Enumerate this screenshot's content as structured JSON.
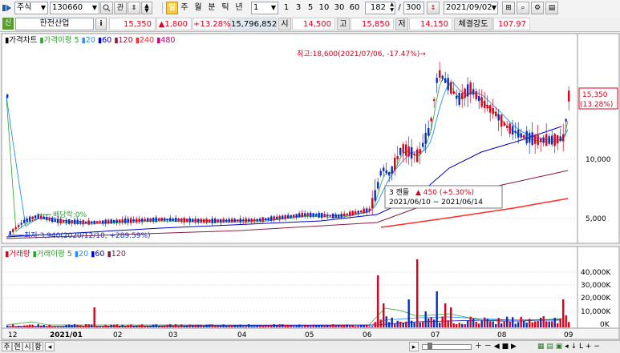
{
  "toolbar": {
    "market_select": "주식",
    "code": "130660",
    "chip_gwan": "관",
    "period_active": "일",
    "periods": [
      "주",
      "월",
      "분",
      "틱",
      "년"
    ],
    "interval_select": "1",
    "quick_intervals": [
      "1",
      "3",
      "5",
      "10",
      "30",
      "60"
    ],
    "count_value": "182",
    "total_value": "300",
    "date_value": "2021/09/02"
  },
  "quote": {
    "badge": "신",
    "name": "한전산업",
    "info": "i",
    "price": "15,350",
    "change": "▲1,800",
    "change_pct": "+13.28%",
    "volume": "15,796,852",
    "open_label": "시",
    "open": "14,500",
    "high_label": "고",
    "high": "15,850",
    "low_label": "저",
    "low": "14,150",
    "strength_label": "체결강도",
    "strength": "107.97"
  },
  "price_panel": {
    "legend": [
      "가격차트",
      "가격이평 5",
      "20",
      "60",
      "120",
      "240",
      "480"
    ],
    "high_note": "최고:18,600(2021/07/06, -17.47%)→",
    "low_note": "최저:3,940(2020/12/10, +289.59%)",
    "dividend_note": "배당락:0%",
    "tooltip_line1_a": "3 캔들",
    "tooltip_line1_b": "▲ 450 (+5.30%)",
    "tooltip_line2": "2021/06/10 ~ 2021/06/14",
    "yticks": [
      "10,000",
      "5,000"
    ],
    "last_price": "15,350",
    "last_pct": "(13.28%)"
  },
  "volume_panel": {
    "legend": [
      "거래량",
      "거래이평 5",
      "20",
      "60",
      "120"
    ],
    "yticks": [
      "40,000K",
      "30,000K",
      "20,000K",
      "10,000K",
      "0K"
    ]
  },
  "xaxis": [
    "12",
    "2021/01",
    "02",
    "03",
    "04",
    "05",
    "06",
    "07",
    "08",
    "09"
  ],
  "statusbar": {
    "tabs": [
      "주",
      "현",
      "시",
      "황"
    ]
  },
  "colors": {
    "up": "#e0001b",
    "down": "#0b2fbd",
    "ma5": "#2aa12a",
    "ma20": "#1e90ff",
    "ma60": "#0000cc",
    "ma120": "#8b1a3a",
    "ma240": "#ff2a2a",
    "ma480": "#c8007a"
  },
  "icons": [
    "minimize-icon",
    "search-icon",
    "updown-icon",
    "settings-icon",
    "print-icon"
  ]
}
